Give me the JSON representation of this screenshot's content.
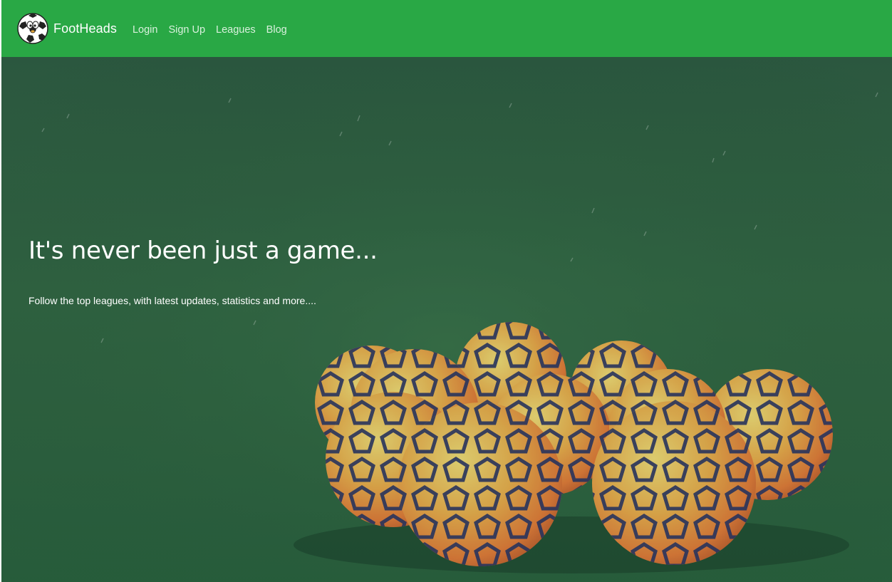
{
  "navbar": {
    "brand": "FootHeads",
    "links": [
      "Login",
      "Sign Up",
      "Leagues",
      "Blog"
    ],
    "background_color": "#29a845"
  },
  "hero": {
    "title": "It's never been just a game...",
    "subtitle": "Follow the top leagues, with latest updates, statistics and more....",
    "image": "soccer-balls-on-grass"
  },
  "icons": {
    "brand_logo": "soccer-ball-mascot-icon"
  }
}
